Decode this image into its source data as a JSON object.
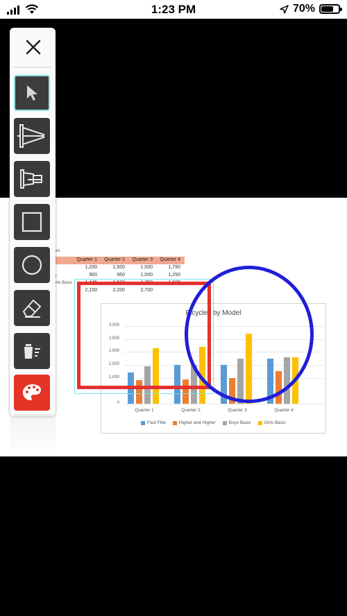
{
  "status_bar": {
    "time": "1:23 PM",
    "battery": "70%",
    "battery_level": 0.7
  },
  "toolbar": {
    "close_icon": "close-icon",
    "tools": [
      {
        "name": "pointer",
        "icon": "cursor-arrow-icon",
        "active": true
      },
      {
        "name": "laser-pointer",
        "icon": "laser-pointer-icon",
        "active": false
      },
      {
        "name": "highlighter",
        "icon": "highlighter-icon",
        "active": false
      },
      {
        "name": "rectangle",
        "icon": "rectangle-icon",
        "active": false
      },
      {
        "name": "circle",
        "icon": "circle-icon",
        "active": false
      },
      {
        "name": "eraser",
        "icon": "eraser-icon",
        "active": false
      },
      {
        "name": "clear-all",
        "icon": "trash-icon",
        "active": false
      },
      {
        "name": "color-palette",
        "icon": "palette-icon",
        "active": false
      }
    ],
    "palette_color": "#e53427",
    "active_border_color": "#8ee3e8"
  },
  "slide": {
    "title": "odel",
    "label_1": "es",
    "label_2": "r",
    "label_3": "irls Basic",
    "table": {
      "headers": [
        "Quarter 1",
        "Quarter 2",
        "Quarter 3",
        "Quarter 4"
      ],
      "rows": [
        [
          "1,200",
          "1,500",
          "1,500",
          "1,750"
        ],
        [
          "900",
          "950",
          "1,000",
          "1,250"
        ],
        [
          "1,445",
          "1,500",
          "1,750",
          "1,800"
        ],
        [
          "2,150",
          "2,200",
          "2,700",
          ""
        ]
      ]
    }
  },
  "chart_data": {
    "type": "bar",
    "title": "Bicycles by Model",
    "categories": [
      "Quarter 1",
      "Quarter 2",
      "Quarter 3",
      "Quarter 4"
    ],
    "ylim": [
      0,
      3000
    ],
    "yticks": [
      "3,000",
      "2,500",
      "2,000",
      "1,500",
      "1,000",
      "0"
    ],
    "ytick_values": [
      3000,
      2500,
      2000,
      1500,
      1000,
      0
    ],
    "series": [
      {
        "name": "Fast Flite",
        "color": "#5b9bd5",
        "values": [
          1200,
          1500,
          1500,
          1750
        ]
      },
      {
        "name": "Higher and Higher",
        "color": "#ed7d31",
        "values": [
          900,
          950,
          1000,
          1250
        ]
      },
      {
        "name": "Boys Basic",
        "color": "#a5a5a5",
        "values": [
          1445,
          1500,
          1750,
          1800
        ]
      },
      {
        "name": "Girls Basic",
        "color": "#ffc000",
        "values": [
          2150,
          2200,
          2700,
          1800
        ]
      }
    ],
    "legend_position": "bottom",
    "grid": true
  },
  "annotations": {
    "rectangle_color": "#e3322f",
    "circle_color": "#1f1fd8",
    "selection_color": "#7fe3ef"
  }
}
